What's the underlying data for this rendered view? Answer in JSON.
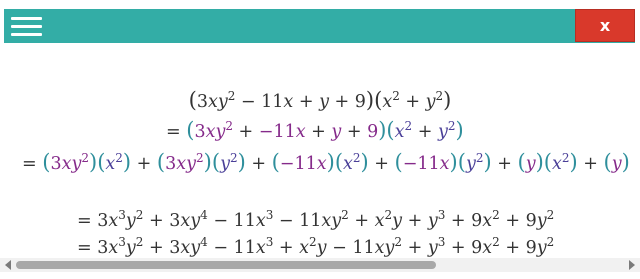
{
  "toolbar": {
    "menu_icon": "hamburger-menu-icon",
    "close_label": "x",
    "bar_color": "#33ada6",
    "close_color": "#d9392b"
  },
  "colors": {
    "teal": "#2f8f9c",
    "purple": "#852a8a",
    "blue": "#4a3f98",
    "text": "#333333"
  },
  "scrollbar": {
    "thumb_fraction": 0.69,
    "position_fraction": 0.0
  },
  "math": {
    "lines": [
      {
        "id": "line-1",
        "tokens": [
          {
            "t": "(",
            "c": "dark",
            "p": 1
          },
          {
            "t": "3",
            "c": "dark"
          },
          {
            "t": "x",
            "c": "dark",
            "v": 1
          },
          {
            "t": "y",
            "c": "dark",
            "v": 1
          },
          {
            "t": "2",
            "c": "dark",
            "s": 1
          },
          {
            "t": " − 11",
            "c": "dark"
          },
          {
            "t": "x",
            "c": "dark",
            "v": 1
          },
          {
            "t": " + ",
            "c": "dark"
          },
          {
            "t": "y",
            "c": "dark",
            "v": 1
          },
          {
            "t": " + 9",
            "c": "dark"
          },
          {
            "t": ")",
            "c": "dark",
            "p": 1
          },
          {
            "t": "(",
            "c": "dark",
            "p": 1
          },
          {
            "t": "x",
            "c": "dark",
            "v": 1
          },
          {
            "t": "2",
            "c": "dark",
            "s": 1
          },
          {
            "t": " + ",
            "c": "dark"
          },
          {
            "t": "y",
            "c": "dark",
            "v": 1
          },
          {
            "t": "2",
            "c": "dark",
            "s": 1
          },
          {
            "t": ")",
            "c": "dark",
            "p": 1
          }
        ]
      },
      {
        "id": "line-2",
        "tokens": [
          {
            "t": "= ",
            "c": "dark"
          },
          {
            "t": "(",
            "c": "teal",
            "p": 1
          },
          {
            "t": "3",
            "c": "purple"
          },
          {
            "t": "x",
            "c": "purple",
            "v": 1
          },
          {
            "t": "y",
            "c": "purple",
            "v": 1
          },
          {
            "t": "2",
            "c": "purple",
            "s": 1
          },
          {
            "t": " + ",
            "c": "dark"
          },
          {
            "t": "−11",
            "c": "purple"
          },
          {
            "t": "x",
            "c": "purple",
            "v": 1
          },
          {
            "t": " + ",
            "c": "dark"
          },
          {
            "t": "y",
            "c": "purple",
            "v": 1
          },
          {
            "t": " + ",
            "c": "dark"
          },
          {
            "t": "9",
            "c": "purple"
          },
          {
            "t": ")",
            "c": "teal",
            "p": 1
          },
          {
            "t": "(",
            "c": "teal",
            "p": 1
          },
          {
            "t": "x",
            "c": "blue",
            "v": 1
          },
          {
            "t": "2",
            "c": "blue",
            "s": 1
          },
          {
            "t": " + ",
            "c": "dark"
          },
          {
            "t": "y",
            "c": "blue",
            "v": 1
          },
          {
            "t": "2",
            "c": "blue",
            "s": 1
          },
          {
            "t": ")",
            "c": "teal",
            "p": 1
          }
        ]
      },
      {
        "id": "line-3",
        "tokens": [
          {
            "t": "= ",
            "c": "dark"
          },
          {
            "t": "(",
            "c": "teal",
            "p": 1
          },
          {
            "t": "3",
            "c": "purple"
          },
          {
            "t": "x",
            "c": "purple",
            "v": 1
          },
          {
            "t": "y",
            "c": "purple",
            "v": 1
          },
          {
            "t": "2",
            "c": "purple",
            "s": 1
          },
          {
            "t": ")",
            "c": "teal",
            "p": 1
          },
          {
            "t": "(",
            "c": "teal",
            "p": 1
          },
          {
            "t": "x",
            "c": "blue",
            "v": 1
          },
          {
            "t": "2",
            "c": "blue",
            "s": 1
          },
          {
            "t": ")",
            "c": "teal",
            "p": 1
          },
          {
            "t": " + ",
            "c": "dark"
          },
          {
            "t": "(",
            "c": "teal",
            "p": 1
          },
          {
            "t": "3",
            "c": "purple"
          },
          {
            "t": "x",
            "c": "purple",
            "v": 1
          },
          {
            "t": "y",
            "c": "purple",
            "v": 1
          },
          {
            "t": "2",
            "c": "purple",
            "s": 1
          },
          {
            "t": ")",
            "c": "teal",
            "p": 1
          },
          {
            "t": "(",
            "c": "teal",
            "p": 1
          },
          {
            "t": "y",
            "c": "blue",
            "v": 1
          },
          {
            "t": "2",
            "c": "blue",
            "s": 1
          },
          {
            "t": ")",
            "c": "teal",
            "p": 1
          },
          {
            "t": " + ",
            "c": "dark"
          },
          {
            "t": "(",
            "c": "teal",
            "p": 1
          },
          {
            "t": "−11",
            "c": "purple"
          },
          {
            "t": "x",
            "c": "purple",
            "v": 1
          },
          {
            "t": ")",
            "c": "teal",
            "p": 1
          },
          {
            "t": "(",
            "c": "teal",
            "p": 1
          },
          {
            "t": "x",
            "c": "blue",
            "v": 1
          },
          {
            "t": "2",
            "c": "blue",
            "s": 1
          },
          {
            "t": ")",
            "c": "teal",
            "p": 1
          },
          {
            "t": " + ",
            "c": "dark"
          },
          {
            "t": "(",
            "c": "teal",
            "p": 1
          },
          {
            "t": "−11",
            "c": "purple"
          },
          {
            "t": "x",
            "c": "purple",
            "v": 1
          },
          {
            "t": ")",
            "c": "teal",
            "p": 1
          },
          {
            "t": "(",
            "c": "teal",
            "p": 1
          },
          {
            "t": "y",
            "c": "blue",
            "v": 1
          },
          {
            "t": "2",
            "c": "blue",
            "s": 1
          },
          {
            "t": ")",
            "c": "teal",
            "p": 1
          },
          {
            "t": " + ",
            "c": "dark"
          },
          {
            "t": "(",
            "c": "teal",
            "p": 1
          },
          {
            "t": "y",
            "c": "purple",
            "v": 1
          },
          {
            "t": ")",
            "c": "teal",
            "p": 1
          },
          {
            "t": "(",
            "c": "teal",
            "p": 1
          },
          {
            "t": "x",
            "c": "blue",
            "v": 1
          },
          {
            "t": "2",
            "c": "blue",
            "s": 1
          },
          {
            "t": ")",
            "c": "teal",
            "p": 1
          },
          {
            "t": " + ",
            "c": "dark"
          },
          {
            "t": "(",
            "c": "teal",
            "p": 1
          },
          {
            "t": "y",
            "c": "purple",
            "v": 1
          },
          {
            "t": ")",
            "c": "teal",
            "p": 1
          }
        ]
      },
      {
        "id": "line-4",
        "tokens": [
          {
            "t": "= 3",
            "c": "dark"
          },
          {
            "t": "x",
            "c": "dark",
            "v": 1
          },
          {
            "t": "3",
            "c": "dark",
            "s": 1
          },
          {
            "t": "y",
            "c": "dark",
            "v": 1
          },
          {
            "t": "2",
            "c": "dark",
            "s": 1
          },
          {
            "t": " + 3",
            "c": "dark"
          },
          {
            "t": "x",
            "c": "dark",
            "v": 1
          },
          {
            "t": "y",
            "c": "dark",
            "v": 1
          },
          {
            "t": "4",
            "c": "dark",
            "s": 1
          },
          {
            "t": " − 11",
            "c": "dark"
          },
          {
            "t": "x",
            "c": "dark",
            "v": 1
          },
          {
            "t": "3",
            "c": "dark",
            "s": 1
          },
          {
            "t": " − 11",
            "c": "dark"
          },
          {
            "t": "x",
            "c": "dark",
            "v": 1
          },
          {
            "t": "y",
            "c": "dark",
            "v": 1
          },
          {
            "t": "2",
            "c": "dark",
            "s": 1
          },
          {
            "t": " + ",
            "c": "dark"
          },
          {
            "t": "x",
            "c": "dark",
            "v": 1
          },
          {
            "t": "2",
            "c": "dark",
            "s": 1
          },
          {
            "t": "y",
            "c": "dark",
            "v": 1
          },
          {
            "t": " + ",
            "c": "dark"
          },
          {
            "t": "y",
            "c": "dark",
            "v": 1
          },
          {
            "t": "3",
            "c": "dark",
            "s": 1
          },
          {
            "t": " + 9",
            "c": "dark"
          },
          {
            "t": "x",
            "c": "dark",
            "v": 1
          },
          {
            "t": "2",
            "c": "dark",
            "s": 1
          },
          {
            "t": " + 9",
            "c": "dark"
          },
          {
            "t": "y",
            "c": "dark",
            "v": 1
          },
          {
            "t": "2",
            "c": "dark",
            "s": 1
          }
        ]
      },
      {
        "id": "line-5",
        "tokens": [
          {
            "t": "= 3",
            "c": "dark"
          },
          {
            "t": "x",
            "c": "dark",
            "v": 1
          },
          {
            "t": "3",
            "c": "dark",
            "s": 1
          },
          {
            "t": "y",
            "c": "dark",
            "v": 1
          },
          {
            "t": "2",
            "c": "dark",
            "s": 1
          },
          {
            "t": " + 3",
            "c": "dark"
          },
          {
            "t": "x",
            "c": "dark",
            "v": 1
          },
          {
            "t": "y",
            "c": "dark",
            "v": 1
          },
          {
            "t": "4",
            "c": "dark",
            "s": 1
          },
          {
            "t": " − 11",
            "c": "dark"
          },
          {
            "t": "x",
            "c": "dark",
            "v": 1
          },
          {
            "t": "3",
            "c": "dark",
            "s": 1
          },
          {
            "t": " + ",
            "c": "dark"
          },
          {
            "t": "x",
            "c": "dark",
            "v": 1
          },
          {
            "t": "2",
            "c": "dark",
            "s": 1
          },
          {
            "t": "y",
            "c": "dark",
            "v": 1
          },
          {
            "t": " − 11",
            "c": "dark"
          },
          {
            "t": "x",
            "c": "dark",
            "v": 1
          },
          {
            "t": "y",
            "c": "dark",
            "v": 1
          },
          {
            "t": "2",
            "c": "dark",
            "s": 1
          },
          {
            "t": " + ",
            "c": "dark"
          },
          {
            "t": "y",
            "c": "dark",
            "v": 1
          },
          {
            "t": "3",
            "c": "dark",
            "s": 1
          },
          {
            "t": " + 9",
            "c": "dark"
          },
          {
            "t": "x",
            "c": "dark",
            "v": 1
          },
          {
            "t": "2",
            "c": "dark",
            "s": 1
          },
          {
            "t": " + 9",
            "c": "dark"
          },
          {
            "t": "y",
            "c": "dark",
            "v": 1
          },
          {
            "t": "2",
            "c": "dark",
            "s": 1
          }
        ]
      }
    ]
  }
}
